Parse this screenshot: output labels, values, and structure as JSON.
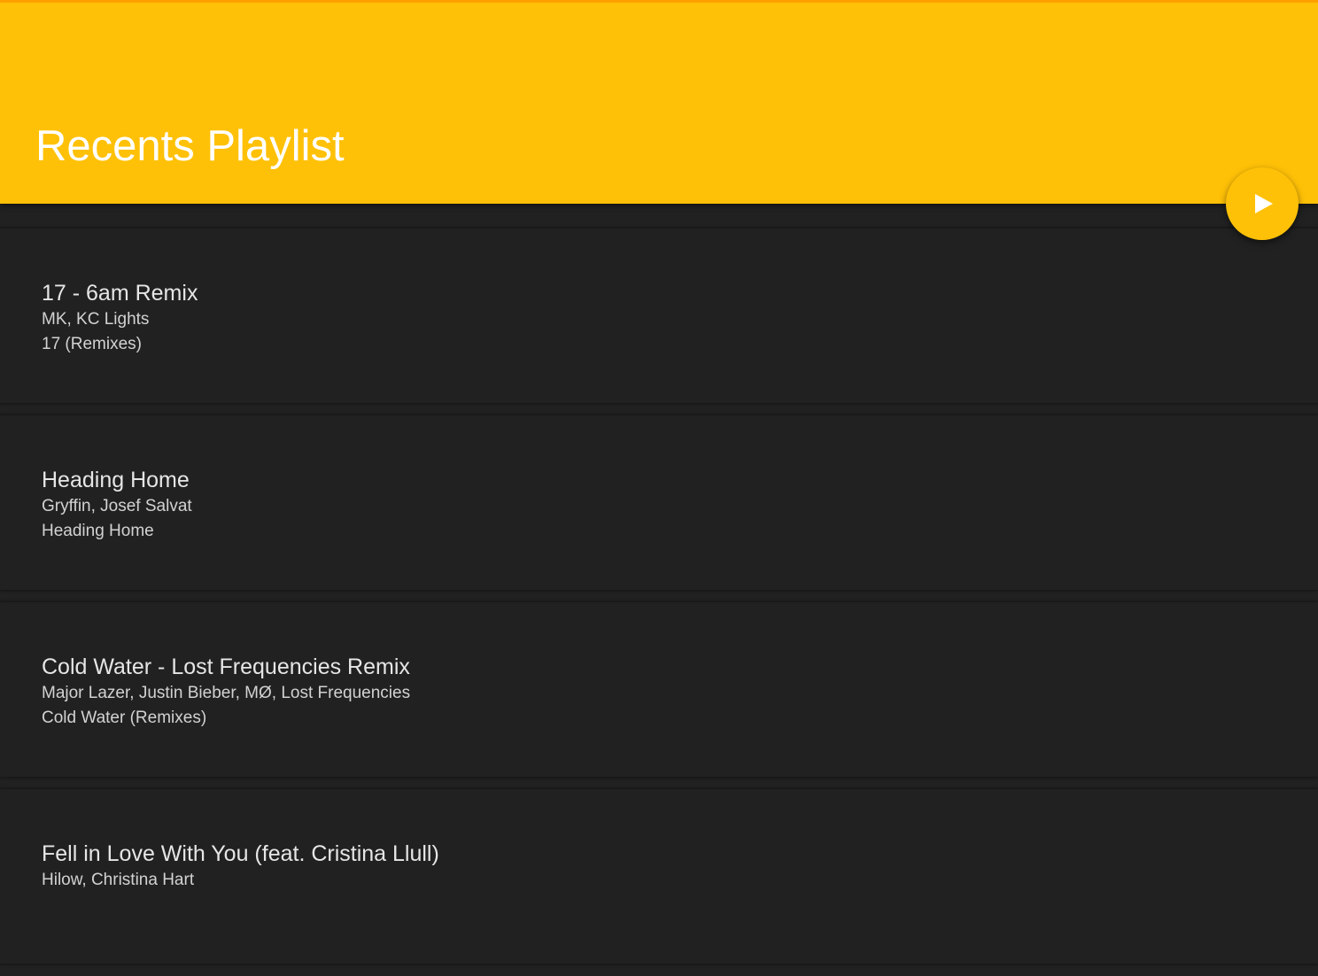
{
  "header": {
    "title": "Recents Playlist",
    "background_color": "#FFC107",
    "play_button_icon": "play-icon"
  },
  "tracks": [
    {
      "title": "17 - 6am Remix",
      "artists": "MK, KC Lights",
      "album": "17 (Remixes)"
    },
    {
      "title": "Heading Home",
      "artists": "Gryffin, Josef Salvat",
      "album": "Heading Home"
    },
    {
      "title": "Cold Water - Lost Frequencies Remix",
      "artists": "Major Lazer, Justin Bieber, MØ, Lost Frequencies",
      "album": "Cold Water (Remixes)"
    },
    {
      "title": "Fell in Love With You (feat. Cristina Llull)",
      "artists": "Hilow, Christina Hart",
      "album": ""
    }
  ]
}
